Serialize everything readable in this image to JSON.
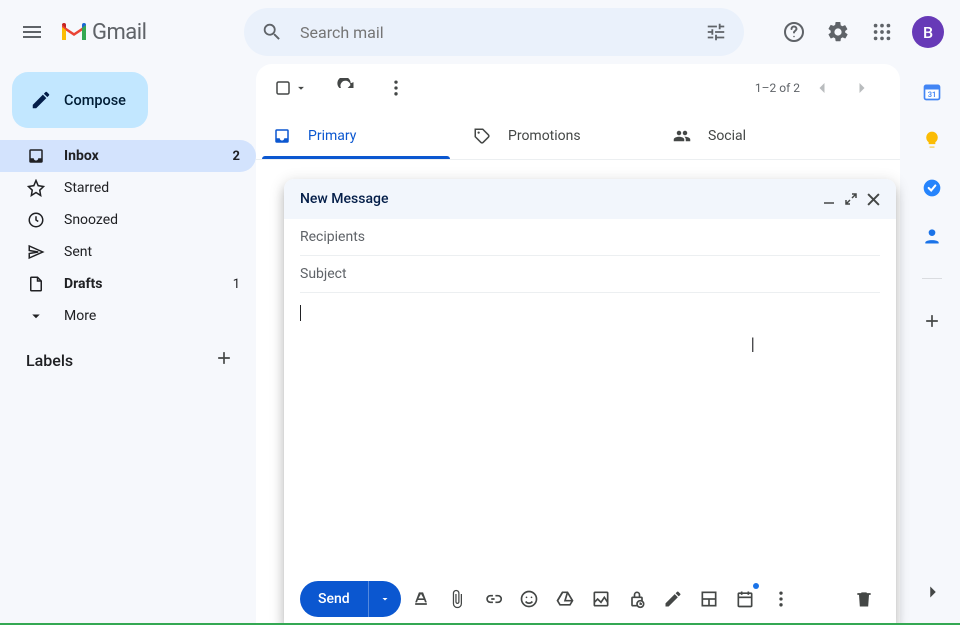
{
  "header": {
    "app_name": "Gmail",
    "search_placeholder": "Search mail",
    "avatar_letter": "B"
  },
  "sidebar": {
    "compose_label": "Compose",
    "items": [
      {
        "label": "Inbox",
        "count": "2",
        "icon": "inbox"
      },
      {
        "label": "Starred",
        "count": "",
        "icon": "star"
      },
      {
        "label": "Snoozed",
        "count": "",
        "icon": "clock"
      },
      {
        "label": "Sent",
        "count": "",
        "icon": "send"
      },
      {
        "label": "Drafts",
        "count": "1",
        "icon": "draft"
      },
      {
        "label": "More",
        "count": "",
        "icon": "chevron"
      }
    ],
    "labels_heading": "Labels"
  },
  "toolbar": {
    "range": "1–2 of 2"
  },
  "tabs": [
    {
      "label": "Primary"
    },
    {
      "label": "Promotions"
    },
    {
      "label": "Social"
    }
  ],
  "compose": {
    "title": "New Message",
    "recipients_placeholder": "Recipients",
    "subject_placeholder": "Subject",
    "body": "",
    "send_label": "Send"
  },
  "rail": {
    "calendar_day": "31"
  }
}
